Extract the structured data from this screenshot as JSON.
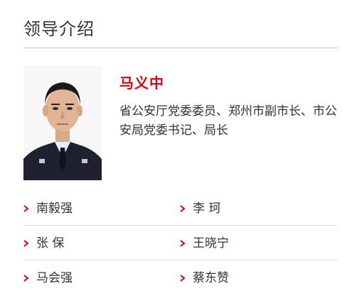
{
  "section": {
    "title": "领导介绍"
  },
  "leader": {
    "name": "马义中",
    "title": "省公安厅党委委员、郑州市副市长、市公安局党委书记、局长",
    "photo_icon": "portrait-photo"
  },
  "members": [
    {
      "name": "南毅强"
    },
    {
      "name": "李 珂"
    },
    {
      "name": "张 保"
    },
    {
      "name": "王晓宁"
    },
    {
      "name": "马会强"
    },
    {
      "name": "蔡东赞"
    }
  ],
  "colors": {
    "accent": "#d7000f",
    "text": "#333333",
    "divider": "#d9d9d9"
  }
}
